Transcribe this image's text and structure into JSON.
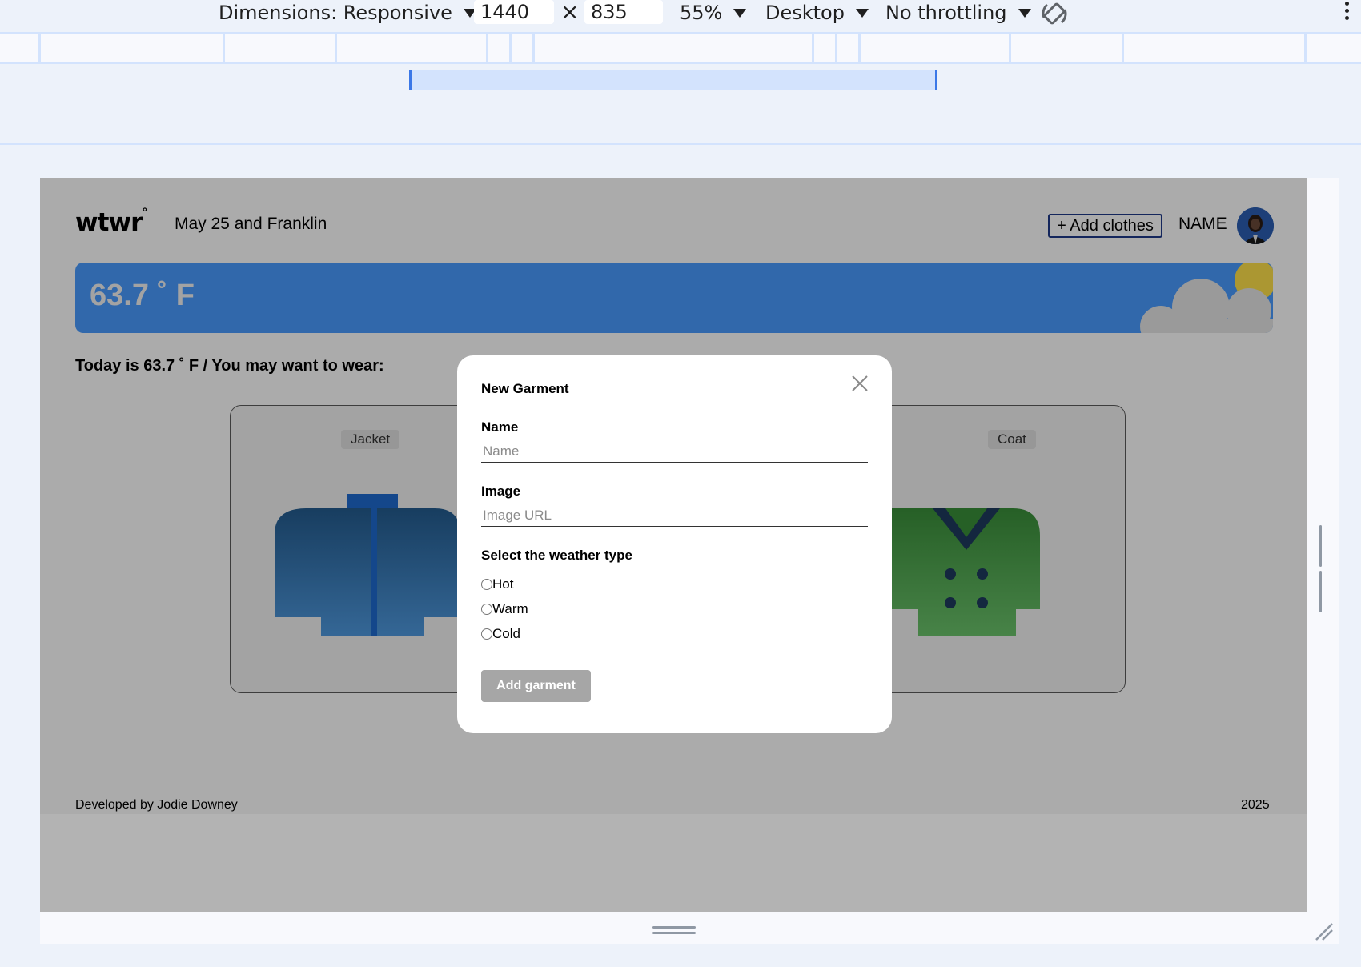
{
  "devtools": {
    "dimensions_label": "Dimensions: Responsive",
    "width_value": "1440",
    "times": "×",
    "height_value": "835",
    "zoom": "55%",
    "device_type": "Desktop",
    "throttling": "No throttling",
    "icons": [
      "rotate-icon",
      "more-vert-icon"
    ]
  },
  "app": {
    "logo": "wtwr",
    "logo_mark": "°",
    "location": "May 25 and Franklin",
    "add_clothes": "+ Add clothes",
    "username": "NAME",
    "weather_temp": "63.7 ˚ F",
    "today_text": "Today is 63.7 ˚ F / You may want to wear:",
    "cards": [
      {
        "label": "Jacket"
      },
      {
        "label": "Coat"
      }
    ],
    "footer_credit": "Developed by Jodie Downey",
    "footer_year": "2025"
  },
  "modal": {
    "title": "New Garment",
    "name_label": "Name",
    "name_placeholder": "Name",
    "image_label": "Image",
    "image_placeholder": "Image URL",
    "weather_label": "Select the weather type",
    "options": [
      "Hot",
      "Warm",
      "Cold"
    ],
    "submit": "Add garment"
  },
  "colors": {
    "weather_card": "#4a9cff",
    "overlay": "rgba(0,0,0,0.33)",
    "devtools_bg": "#edf2fa",
    "accent": "#1e3a8a"
  }
}
